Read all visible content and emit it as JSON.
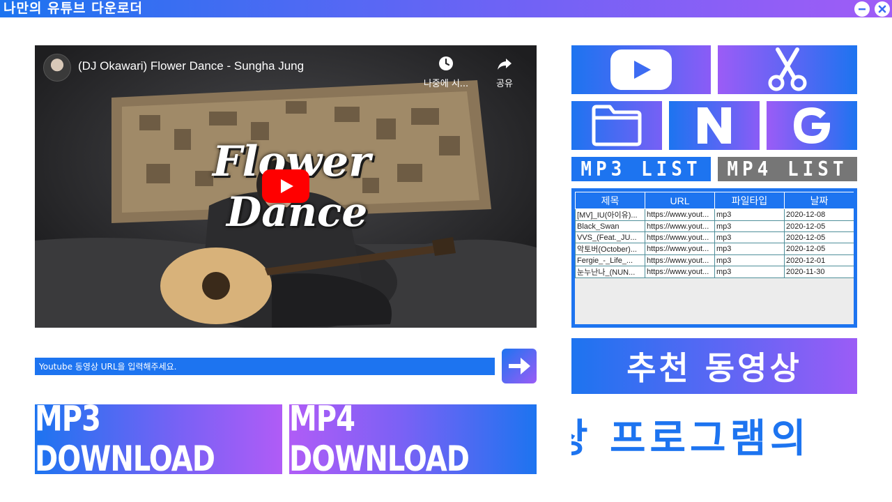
{
  "window": {
    "title": "나만의 유튜브 다운로더",
    "minimize_icon": "minus-icon",
    "close_icon": "close-icon"
  },
  "video": {
    "title": "(DJ Okawari) Flower Dance - Sungha Jung",
    "watch_later_label": "나중에 시...",
    "share_label": "공유",
    "overlay_line1": "Flower",
    "overlay_line2": "Dance"
  },
  "url_input": {
    "placeholder": "Youtube 동영상 URL을 입력해주세요.",
    "value": ""
  },
  "buttons": {
    "mp3_download": "MP3 DOWNLOAD",
    "mp4_download": "MP4 DOWNLOAD",
    "recommend": "추천 동영상",
    "mp3_list": "MP3 LIST",
    "mp4_list": "MP4 LIST"
  },
  "tiles": [
    {
      "name": "youtube-icon"
    },
    {
      "name": "scissors-icon"
    },
    {
      "name": "folder-icon"
    },
    {
      "name": "naver-icon"
    },
    {
      "name": "google-icon"
    }
  ],
  "table": {
    "headers": [
      "제목",
      "URL",
      "파일타입",
      "날짜"
    ],
    "rows": [
      [
        "[MV]_IU(아이유)...",
        "https://www.yout...",
        "mp3",
        "2020-12-08"
      ],
      [
        "Black_Swan",
        "https://www.yout...",
        "mp3",
        "2020-12-05"
      ],
      [
        "VVS_(Feat._JU...",
        "https://www.yout...",
        "mp3",
        "2020-12-05"
      ],
      [
        "악토버(October)...",
        "https://www.yout...",
        "mp3",
        "2020-12-05"
      ],
      [
        "Fergie_-_Life_...",
        "https://www.yout...",
        "mp3",
        "2020-12-01"
      ],
      [
        "눈누난나_(NUN...",
        "https://www.yout...",
        "mp3",
        "2020-11-30"
      ]
    ]
  },
  "marquee": {
    "text": "상 프로그램의 "
  },
  "colors": {
    "primary": "#1d74f0",
    "accent": "#9b5cf6",
    "list_tab_inactive": "#767676"
  }
}
